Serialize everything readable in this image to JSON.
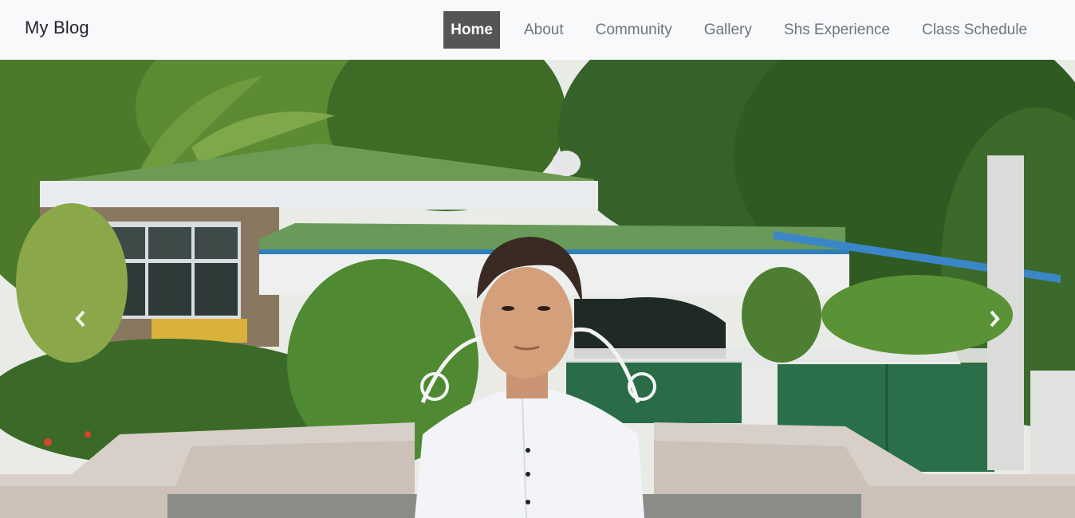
{
  "brand": "My Blog",
  "nav": {
    "items": [
      {
        "label": "Home",
        "active": true
      },
      {
        "label": "About"
      },
      {
        "label": "Community"
      },
      {
        "label": "Gallery"
      },
      {
        "label": "Shs Experience"
      },
      {
        "label": "Class Schedule"
      }
    ]
  },
  "carousel": {
    "prev_icon": "chevron-left-icon",
    "next_icon": "chevron-right-icon"
  },
  "colors": {
    "active_bg": "#555555",
    "nav_text": "#6c757d",
    "navbar_bg": "#f8f9fa"
  }
}
